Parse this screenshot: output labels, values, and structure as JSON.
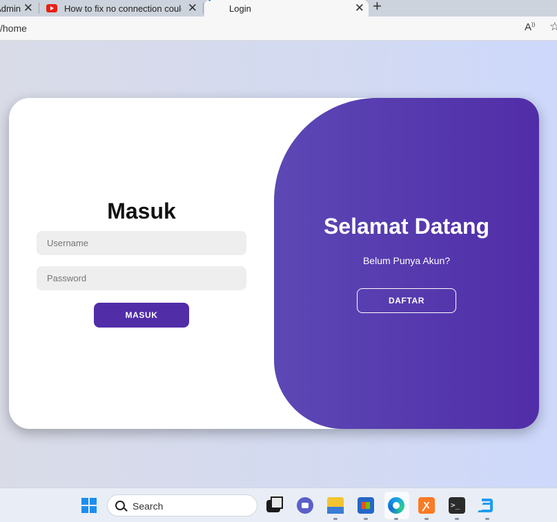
{
  "browser": {
    "tabs": [
      {
        "label": "yAdmin",
        "close": "✕"
      },
      {
        "label": "How to fix no connection could be",
        "close": "✕"
      },
      {
        "label": "Login",
        "close": "✕"
      }
    ],
    "new_tab": "+",
    "url": "/home",
    "icons": [
      "read-aloud-icon",
      "favorite-star-icon"
    ]
  },
  "signin": {
    "title": "Masuk",
    "username_placeholder": "Username",
    "password_placeholder": "Password",
    "button_label": "MASUK"
  },
  "welcome": {
    "title": "Selamat Datang",
    "text": "Belum Punya Akun?",
    "button_label": "DAFTAR"
  },
  "taskbar": {
    "search_label": "Search",
    "xampp_glyph": "ꭗ",
    "terminal_glyph": ">_",
    "apps": [
      "windows-start-icon",
      "task-view-icon",
      "chat-icon",
      "file-explorer-icon",
      "store-icon",
      "edge-icon",
      "xampp-icon",
      "terminal-icon",
      "vscode-icon"
    ]
  },
  "colors": {
    "accent": "#512da8",
    "panel_gradient_start": "#5c48b5",
    "input_bg": "#eeeeee",
    "page_bg": "#d3daf1"
  }
}
